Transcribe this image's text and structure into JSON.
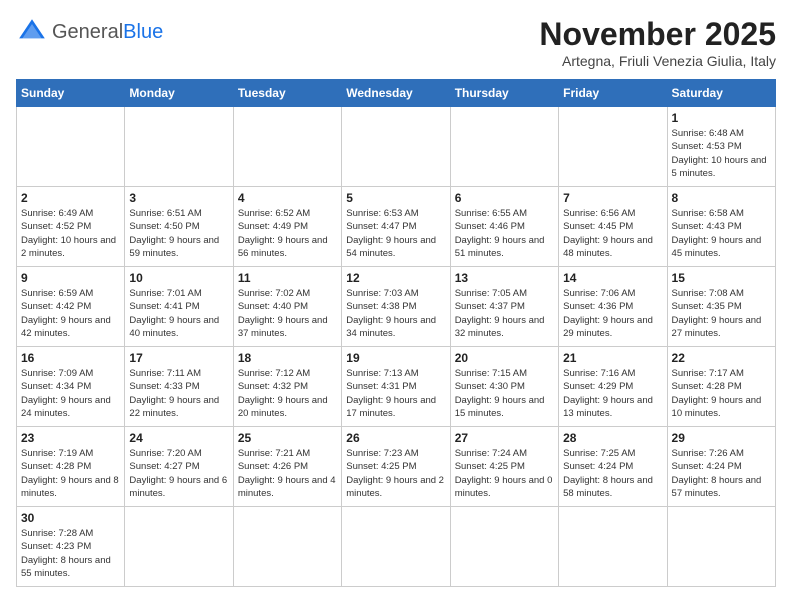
{
  "logo": {
    "general": "General",
    "blue": "Blue"
  },
  "title": "November 2025",
  "location": "Artegna, Friuli Venezia Giulia, Italy",
  "days_of_week": [
    "Sunday",
    "Monday",
    "Tuesday",
    "Wednesday",
    "Thursday",
    "Friday",
    "Saturday"
  ],
  "weeks": [
    [
      {
        "day": "",
        "info": ""
      },
      {
        "day": "",
        "info": ""
      },
      {
        "day": "",
        "info": ""
      },
      {
        "day": "",
        "info": ""
      },
      {
        "day": "",
        "info": ""
      },
      {
        "day": "",
        "info": ""
      },
      {
        "day": "1",
        "info": "Sunrise: 6:48 AM\nSunset: 4:53 PM\nDaylight: 10 hours and 5 minutes."
      }
    ],
    [
      {
        "day": "2",
        "info": "Sunrise: 6:49 AM\nSunset: 4:52 PM\nDaylight: 10 hours and 2 minutes."
      },
      {
        "day": "3",
        "info": "Sunrise: 6:51 AM\nSunset: 4:50 PM\nDaylight: 9 hours and 59 minutes."
      },
      {
        "day": "4",
        "info": "Sunrise: 6:52 AM\nSunset: 4:49 PM\nDaylight: 9 hours and 56 minutes."
      },
      {
        "day": "5",
        "info": "Sunrise: 6:53 AM\nSunset: 4:47 PM\nDaylight: 9 hours and 54 minutes."
      },
      {
        "day": "6",
        "info": "Sunrise: 6:55 AM\nSunset: 4:46 PM\nDaylight: 9 hours and 51 minutes."
      },
      {
        "day": "7",
        "info": "Sunrise: 6:56 AM\nSunset: 4:45 PM\nDaylight: 9 hours and 48 minutes."
      },
      {
        "day": "8",
        "info": "Sunrise: 6:58 AM\nSunset: 4:43 PM\nDaylight: 9 hours and 45 minutes."
      }
    ],
    [
      {
        "day": "9",
        "info": "Sunrise: 6:59 AM\nSunset: 4:42 PM\nDaylight: 9 hours and 42 minutes."
      },
      {
        "day": "10",
        "info": "Sunrise: 7:01 AM\nSunset: 4:41 PM\nDaylight: 9 hours and 40 minutes."
      },
      {
        "day": "11",
        "info": "Sunrise: 7:02 AM\nSunset: 4:40 PM\nDaylight: 9 hours and 37 minutes."
      },
      {
        "day": "12",
        "info": "Sunrise: 7:03 AM\nSunset: 4:38 PM\nDaylight: 9 hours and 34 minutes."
      },
      {
        "day": "13",
        "info": "Sunrise: 7:05 AM\nSunset: 4:37 PM\nDaylight: 9 hours and 32 minutes."
      },
      {
        "day": "14",
        "info": "Sunrise: 7:06 AM\nSunset: 4:36 PM\nDaylight: 9 hours and 29 minutes."
      },
      {
        "day": "15",
        "info": "Sunrise: 7:08 AM\nSunset: 4:35 PM\nDaylight: 9 hours and 27 minutes."
      }
    ],
    [
      {
        "day": "16",
        "info": "Sunrise: 7:09 AM\nSunset: 4:34 PM\nDaylight: 9 hours and 24 minutes."
      },
      {
        "day": "17",
        "info": "Sunrise: 7:11 AM\nSunset: 4:33 PM\nDaylight: 9 hours and 22 minutes."
      },
      {
        "day": "18",
        "info": "Sunrise: 7:12 AM\nSunset: 4:32 PM\nDaylight: 9 hours and 20 minutes."
      },
      {
        "day": "19",
        "info": "Sunrise: 7:13 AM\nSunset: 4:31 PM\nDaylight: 9 hours and 17 minutes."
      },
      {
        "day": "20",
        "info": "Sunrise: 7:15 AM\nSunset: 4:30 PM\nDaylight: 9 hours and 15 minutes."
      },
      {
        "day": "21",
        "info": "Sunrise: 7:16 AM\nSunset: 4:29 PM\nDaylight: 9 hours and 13 minutes."
      },
      {
        "day": "22",
        "info": "Sunrise: 7:17 AM\nSunset: 4:28 PM\nDaylight: 9 hours and 10 minutes."
      }
    ],
    [
      {
        "day": "23",
        "info": "Sunrise: 7:19 AM\nSunset: 4:28 PM\nDaylight: 9 hours and 8 minutes."
      },
      {
        "day": "24",
        "info": "Sunrise: 7:20 AM\nSunset: 4:27 PM\nDaylight: 9 hours and 6 minutes."
      },
      {
        "day": "25",
        "info": "Sunrise: 7:21 AM\nSunset: 4:26 PM\nDaylight: 9 hours and 4 minutes."
      },
      {
        "day": "26",
        "info": "Sunrise: 7:23 AM\nSunset: 4:25 PM\nDaylight: 9 hours and 2 minutes."
      },
      {
        "day": "27",
        "info": "Sunrise: 7:24 AM\nSunset: 4:25 PM\nDaylight: 9 hours and 0 minutes."
      },
      {
        "day": "28",
        "info": "Sunrise: 7:25 AM\nSunset: 4:24 PM\nDaylight: 8 hours and 58 minutes."
      },
      {
        "day": "29",
        "info": "Sunrise: 7:26 AM\nSunset: 4:24 PM\nDaylight: 8 hours and 57 minutes."
      }
    ],
    [
      {
        "day": "30",
        "info": "Sunrise: 7:28 AM\nSunset: 4:23 PM\nDaylight: 8 hours and 55 minutes."
      },
      {
        "day": "",
        "info": ""
      },
      {
        "day": "",
        "info": ""
      },
      {
        "day": "",
        "info": ""
      },
      {
        "day": "",
        "info": ""
      },
      {
        "day": "",
        "info": ""
      },
      {
        "day": "",
        "info": ""
      }
    ]
  ]
}
